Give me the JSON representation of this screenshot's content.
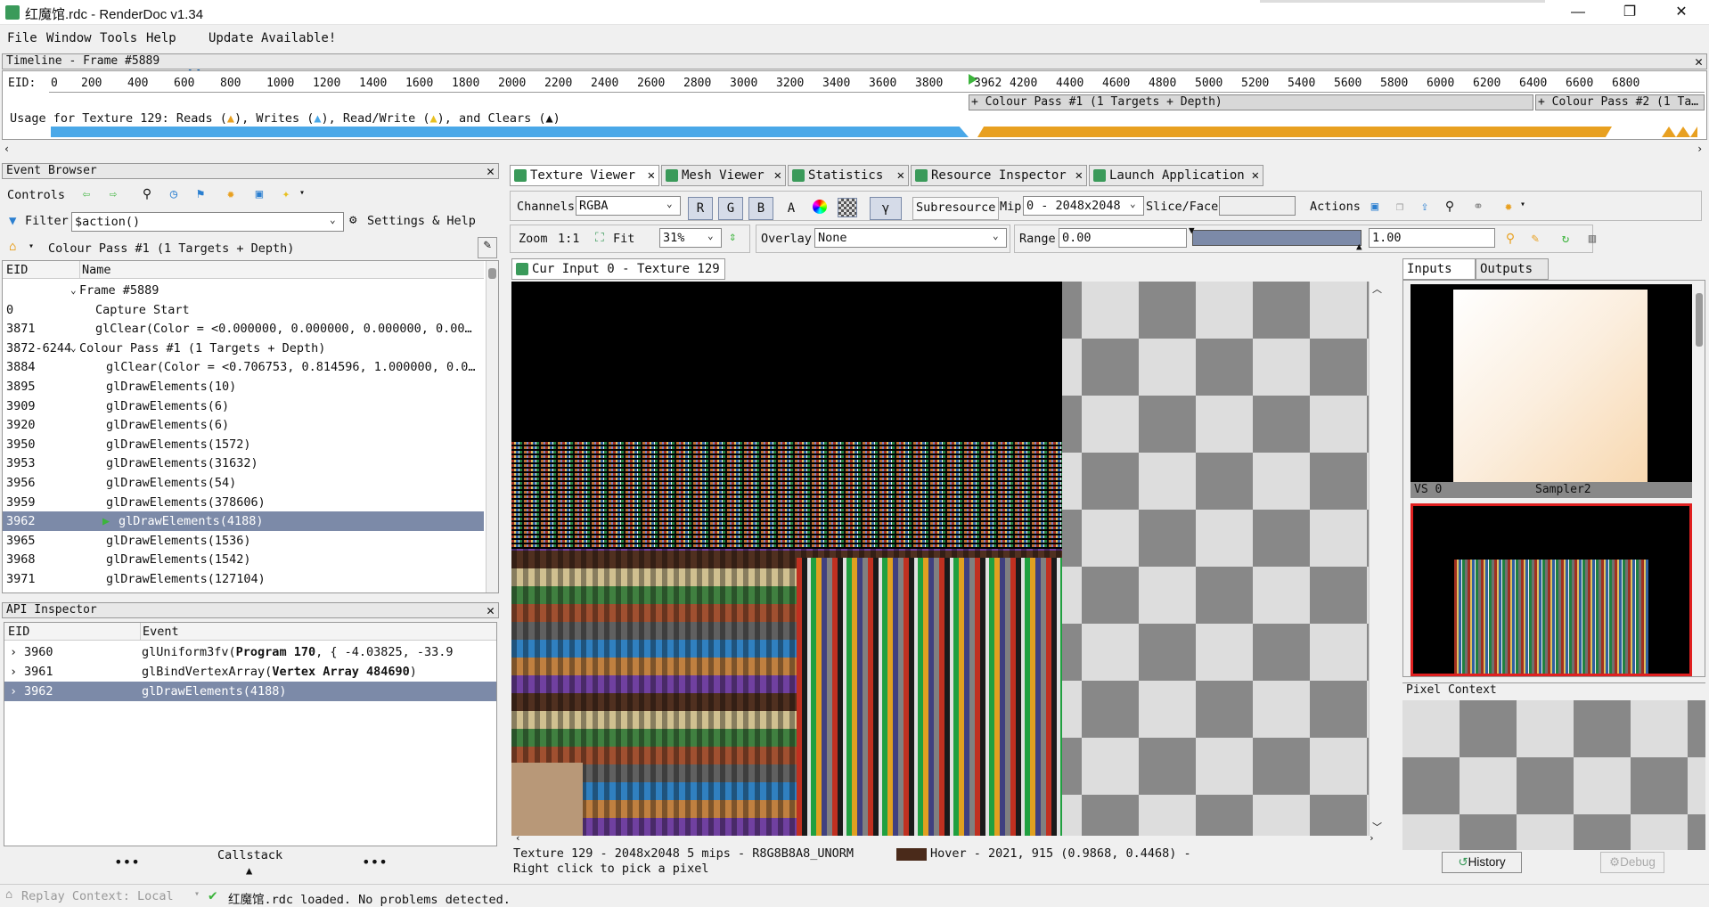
{
  "window": {
    "title": "红魔馆.rdc - RenderDoc v1.34",
    "min": "—",
    "max": "❐",
    "close": "✕"
  },
  "menu": [
    "File",
    "Window",
    "Tools",
    "Help",
    "Update Available!"
  ],
  "timeline": {
    "title": "Timeline - Frame #5889",
    "eid_label": "EID:",
    "ticks": [
      "0",
      "200",
      "400",
      "600",
      "800",
      "1000",
      "1200",
      "1400",
      "1600",
      "1800",
      "2000",
      "2200",
      "2400",
      "2600",
      "2800",
      "3000",
      "3200",
      "3400",
      "3600",
      "3800",
      "3962",
      "4200",
      "4400",
      "4600",
      "4800",
      "5000",
      "5200",
      "5400",
      "5600",
      "5800",
      "6000",
      "6200",
      "6400",
      "6600",
      "6800"
    ],
    "pass1": "+ Colour Pass #1 (1 Targets + Depth)",
    "pass2": "+ Colour Pass #2 (1 Ta…",
    "usage_prefix": "Usage for Texture 129: Reads (",
    "usage_writes": "), Writes (",
    "usage_rw": "), Read/Write (",
    "usage_clears": "), and Clears (",
    "usage_end": ")"
  },
  "event_browser": {
    "title": "Event Browser",
    "controls": "Controls",
    "filter_label": "Filter",
    "filter_value": "$action()",
    "settings": "Settings & Help",
    "breadcrumb": "Colour Pass #1 (1 Targets + Depth)",
    "col_eid": "EID",
    "col_name": "Name",
    "rows": [
      {
        "eid": "",
        "name": "Frame #5889",
        "indent": 0,
        "exp": "⌄"
      },
      {
        "eid": "0",
        "name": "Capture Start",
        "indent": 1,
        "exp": ""
      },
      {
        "eid": "3871",
        "name": "glClear(Color = <0.000000, 0.000000, 0.000000, 0.00…",
        "indent": 1,
        "exp": ""
      },
      {
        "eid": "3872-6244",
        "name": "Colour Pass #1 (1 Targets + Depth)",
        "indent": 0,
        "exp": "⌄"
      },
      {
        "eid": "3884",
        "name": "glClear(Color = <0.706753, 0.814596, 1.000000, 0.0…",
        "indent": 2,
        "exp": ""
      },
      {
        "eid": "3895",
        "name": "glDrawElements(10)",
        "indent": 2,
        "exp": ""
      },
      {
        "eid": "3909",
        "name": "glDrawElements(6)",
        "indent": 2,
        "exp": ""
      },
      {
        "eid": "3920",
        "name": "glDrawElements(6)",
        "indent": 2,
        "exp": ""
      },
      {
        "eid": "3950",
        "name": "glDrawElements(1572)",
        "indent": 2,
        "exp": ""
      },
      {
        "eid": "3953",
        "name": "glDrawElements(31632)",
        "indent": 2,
        "exp": ""
      },
      {
        "eid": "3956",
        "name": "glDrawElements(54)",
        "indent": 2,
        "exp": ""
      },
      {
        "eid": "3959",
        "name": "glDrawElements(378606)",
        "indent": 2,
        "exp": ""
      },
      {
        "eid": "3962",
        "name": "glDrawElements(4188)",
        "indent": 3,
        "exp": "",
        "sel": true
      },
      {
        "eid": "3965",
        "name": "glDrawElements(1536)",
        "indent": 2,
        "exp": ""
      },
      {
        "eid": "3968",
        "name": "glDrawElements(1542)",
        "indent": 2,
        "exp": ""
      },
      {
        "eid": "3971",
        "name": "glDrawElements(127104)",
        "indent": 2,
        "exp": ""
      }
    ]
  },
  "api_inspector": {
    "title": "API Inspector",
    "col_eid": "EID",
    "col_event": "Event",
    "rows": [
      {
        "eid": "3960",
        "pre": "glUniform3fv(",
        "bold": "Program 170",
        "post": ", { -4.03825, -33.9"
      },
      {
        "eid": "3961",
        "pre": "glBindVertexArray(",
        "bold": "Vertex Array 484690",
        "post": ")"
      },
      {
        "eid": "3962",
        "pre": "glDrawElements(4188)",
        "bold": "",
        "post": "",
        "sel": true
      }
    ],
    "callstack": "Callstack",
    "dots": "•••"
  },
  "tabs": [
    "Texture Viewer",
    "Mesh Viewer",
    "Statistics",
    "Resource Inspector",
    "Launch Application"
  ],
  "texture_viewer": {
    "channels_label": "Channels",
    "channels_value": "RGBA",
    "r": "R",
    "g": "G",
    "b": "B",
    "a": "A",
    "gamma": "γ",
    "subresource": "Subresource",
    "mip_label": "Mip",
    "mip_value": "0 - 2048x2048",
    "slice_label": "Slice/Face",
    "actions": "Actions",
    "zoom_label": "Zoom",
    "zoom_1to1": "1:1",
    "fit": "Fit",
    "zoom_value": "31%",
    "overlay_label": "Overlay",
    "overlay_value": "None",
    "range_label": "Range",
    "range_min": "0.00",
    "range_max": "1.00",
    "sub_tab": "Cur Input 0 - Texture 129",
    "status_line1": "Texture 129 - 2048x2048 5 mips - R8G8B8A8_UNORM",
    "status_hover": "Hover -  2021,  915 (0.9868, 0.4468)  -",
    "status_line2": "Right click to pick a pixel",
    "inputs_tab": "Inputs",
    "outputs_tab": "Outputs",
    "thumb_vs": "VS 0",
    "thumb_sampler": "Sampler2",
    "pixel_context": "Pixel Context",
    "history": "History",
    "debug": "Debug"
  },
  "status": {
    "replay": "Replay Context: Local",
    "message": "红魔馆.rdc loaded. No problems detected."
  },
  "colors": {
    "accent": "#7c8aa8",
    "reads": "#4aa8e8",
    "writes": "#e8a020",
    "selected_row": "#7c8aa8",
    "green_icon": "#3a9a5a"
  }
}
